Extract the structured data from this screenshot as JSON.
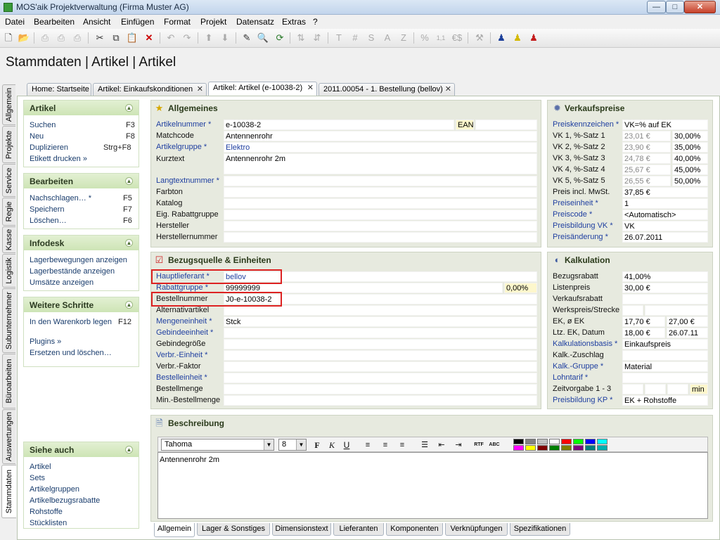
{
  "window": {
    "title": "MOS'aik Projektverwaltung (Firma Muster AG)",
    "minimize": "—",
    "maximize": "□",
    "close": "✕"
  },
  "menu": [
    "Datei",
    "Bearbeiten",
    "Ansicht",
    "Einfügen",
    "Format",
    "Projekt",
    "Datensatz",
    "Extras",
    "?"
  ],
  "toolbar": {
    "icons": [
      "new-file-icon",
      "open-folder-icon",
      "print-preview-icon",
      "print-icon",
      "print-options-icon",
      "cut-icon",
      "copy-icon",
      "paste-icon",
      "delete-icon",
      "undo-icon",
      "redo-icon",
      "arrow-up-icon",
      "arrow-down-icon",
      "edit-pencil-icon",
      "find-icon",
      "refresh-icon",
      "sort-asc-icon",
      "sort-desc-icon",
      "text-t-icon",
      "hash-icon",
      "s-icon",
      "a-icon",
      "z-icon",
      "percent-icon",
      "decimal-icon",
      "currency-icon",
      "tools-icon",
      "user-blue-icon",
      "user-yellow-icon",
      "user-red-icon"
    ],
    "text_labels": {
      "t": "T",
      "hash": "#",
      "s": "S",
      "a": "A",
      "z": "Z",
      "percent": "%",
      "euro": "€$",
      "decimal": "1,1"
    }
  },
  "page_title": "Stammdaten | Artikel | Artikel",
  "vertical_tabs": [
    "Allgemein",
    "Projekte",
    "Service",
    "Regie",
    "Kasse",
    "Logistik",
    "Subunternehmer",
    "Büroarbeiten",
    "Auswertungen",
    "Stammdaten"
  ],
  "doc_tabs": [
    {
      "label": "Home: Startseite",
      "closable": false
    },
    {
      "label": "Artikel: Einkaufskonditionen",
      "closable": true
    },
    {
      "label": "Artikel: Artikel (e-10038-2)",
      "closable": true,
      "active": true
    },
    {
      "label": "2011.00054 - 1. Bestellung (bellov)",
      "closable": true
    }
  ],
  "left_panel": {
    "artikel": {
      "title": "Artikel",
      "items": [
        {
          "label": "Suchen",
          "key": "F3"
        },
        {
          "label": "Neu",
          "key": "F8"
        },
        {
          "label": "Duplizieren",
          "key": "Strg+F8"
        },
        {
          "label": "Etikett drucken »",
          "key": ""
        }
      ]
    },
    "bearbeiten": {
      "title": "Bearbeiten",
      "items": [
        {
          "label": "Nachschlagen… *",
          "key": "F5"
        },
        {
          "label": "Speichern",
          "key": "F7"
        },
        {
          "label": "Löschen…",
          "key": "F6"
        }
      ]
    },
    "infodesk": {
      "title": "Infodesk",
      "items": [
        "Lagerbewegungen anzeigen",
        "Lagerbestände anzeigen",
        "Umsätze anzeigen"
      ]
    },
    "weitere": {
      "title": "Weitere Schritte",
      "items": [
        {
          "label": "In den Warenkorb legen",
          "key": "F12"
        },
        {
          "label": "Plugins »",
          "key": ""
        },
        {
          "label": "Ersetzen und löschen…",
          "key": ""
        }
      ]
    },
    "siehe": {
      "title": "Siehe auch",
      "items": [
        "Artikel",
        "Sets",
        "Artikelgruppen",
        "Artikelbezugsrabatte",
        "Rohstoffe",
        "Stücklisten"
      ]
    }
  },
  "allgemeines": {
    "title": "Allgemeines",
    "rows": [
      {
        "label": "Artikelnummer *",
        "link": true,
        "value": "e-10038-2",
        "extra": "EAN"
      },
      {
        "label": "Matchcode",
        "link": false,
        "value": "Antennenrohr"
      },
      {
        "label": "Artikelgruppe *",
        "link": true,
        "value": "Elektro",
        "blue": true
      },
      {
        "label": "Kurztext",
        "link": false,
        "value": "Antennenrohr 2m"
      },
      {
        "label": "Langtextnummer *",
        "link": true,
        "value": ""
      },
      {
        "label": "Farbton",
        "link": false,
        "value": ""
      },
      {
        "label": "Katalog",
        "link": false,
        "value": ""
      },
      {
        "label": "Eig. Rabattgruppe",
        "link": false,
        "value": ""
      },
      {
        "label": "Hersteller",
        "link": false,
        "value": ""
      },
      {
        "label": "Herstellernummer",
        "link": false,
        "value": ""
      }
    ]
  },
  "verkaufspreise": {
    "title": "Verkaufspreise",
    "rows": [
      {
        "label": "Preiskennzeichen *",
        "link": true,
        "v1": "VK=% auf EK",
        "v2": ""
      },
      {
        "label": "VK 1, %-Satz 1",
        "link": false,
        "v1": "23,01 €",
        "v2": "30,00%"
      },
      {
        "label": "VK 2, %-Satz 2",
        "link": false,
        "v1": "23,90 €",
        "v2": "35,00%"
      },
      {
        "label": "VK 3, %-Satz 3",
        "link": false,
        "v1": "24,78 €",
        "v2": "40,00%"
      },
      {
        "label": "VK 4, %-Satz 4",
        "link": false,
        "v1": "25,67 €",
        "v2": "45,00%"
      },
      {
        "label": "VK 5, %-Satz 5",
        "link": false,
        "v1": "26,55 €",
        "v2": "50,00%"
      },
      {
        "label": "Preis incl. MwSt.",
        "link": false,
        "v1": "37,85 €",
        "v2": ""
      },
      {
        "label": "Preiseinheit *",
        "link": true,
        "v1": "1",
        "v2": ""
      },
      {
        "label": "Preiscode *",
        "link": true,
        "v1": "<Automatisch>",
        "v2": ""
      },
      {
        "label": "Preisbildung VK *",
        "link": true,
        "v1": "VK",
        "v2": ""
      },
      {
        "label": "Preisänderung *",
        "link": true,
        "v1": "26.07.2011",
        "v2": ""
      }
    ]
  },
  "bezugsquelle": {
    "title": "Bezugsquelle & Einheiten",
    "rows": [
      {
        "label": "Hauptlieferant *",
        "link": true,
        "value": "bellov",
        "blue": true
      },
      {
        "label": "Rabattgruppe *",
        "link": true,
        "value": "99999999",
        "extra": "0,00%"
      },
      {
        "label": "Bestellnummer",
        "link": false,
        "value": "J0-e-10038-2"
      },
      {
        "label": "Alternativartikel",
        "link": false,
        "value": ""
      },
      {
        "label": "Mengeneinheit *",
        "link": true,
        "value": "Stck"
      },
      {
        "label": "Gebindeeinheit *",
        "link": true,
        "value": ""
      },
      {
        "label": "Gebindegröße",
        "link": false,
        "value": ""
      },
      {
        "label": "Verbr.-Einheit *",
        "link": true,
        "value": ""
      },
      {
        "label": "Verbr.-Faktor",
        "link": false,
        "value": ""
      },
      {
        "label": "Bestelleinheit *",
        "link": true,
        "value": ""
      },
      {
        "label": "Bestellmenge",
        "link": false,
        "value": ""
      },
      {
        "label": "Min.-Bestellmenge",
        "link": false,
        "value": ""
      }
    ]
  },
  "kalkulation": {
    "title": "Kalkulation",
    "rows": [
      {
        "label": "Bezugsrabatt",
        "link": false,
        "v1": "41,00%",
        "v2": "",
        "v3": ""
      },
      {
        "label": "Listenpreis",
        "link": false,
        "v1": "30,00 €",
        "v2": "",
        "v3": ""
      },
      {
        "label": "Verkaufsrabatt",
        "link": false,
        "v1": "",
        "v2": "",
        "v3": ""
      },
      {
        "label": "Werkspreis/Strecke",
        "link": false,
        "v1": "",
        "v2": "",
        "v3": ""
      },
      {
        "label": "EK, ø EK",
        "link": false,
        "v1": "17,70 €",
        "v2": "27,00 €",
        "v3": ""
      },
      {
        "label": "Ltz. EK, Datum",
        "link": false,
        "v1": "18,00 €",
        "v2": "26.07.11",
        "v3": ""
      },
      {
        "label": "Kalkulationsbasis *",
        "link": true,
        "v1": "Einkaufspreis",
        "v2": "",
        "v3": ""
      },
      {
        "label": "Kalk.-Zuschlag",
        "link": false,
        "v1": "",
        "v2": "",
        "v3": ""
      },
      {
        "label": "Kalk.-Gruppe *",
        "link": true,
        "v1": "Material",
        "v2": "",
        "v3": ""
      },
      {
        "label": "Lohntarif *",
        "link": true,
        "v1": "",
        "v2": "",
        "v3": ""
      },
      {
        "label": "Zeitvorgabe 1 - 3",
        "link": false,
        "v1": "",
        "v2": "",
        "v3": "min"
      },
      {
        "label": "Preisbildung KP *",
        "link": true,
        "v1": "EK + Rohstoffe",
        "v2": "",
        "v3": ""
      }
    ]
  },
  "beschreibung": {
    "title": "Beschreibung",
    "font": "Tahoma",
    "size": "8",
    "bold": "F",
    "italic": "K",
    "underline": "U",
    "rtf": "RTF",
    "abc": "ABC",
    "text": "Antennenrohr 2m",
    "swatches": [
      "#000000",
      "#808080",
      "#c0c0c0",
      "#ffffff",
      "#ff0000",
      "#00ff00",
      "#0000ff",
      "#00ffff",
      "#ff00ff",
      "#ffff00",
      "#800000",
      "#008000",
      "#808000",
      "#800080",
      "#008080",
      "#00b0b0"
    ]
  },
  "bottom_tabs": [
    "Allgemein",
    "Lager & Sonstiges",
    "Dimensionstext",
    "Lieferanten",
    "Komponenten",
    "Verknüpfungen",
    "Spezifikationen"
  ]
}
